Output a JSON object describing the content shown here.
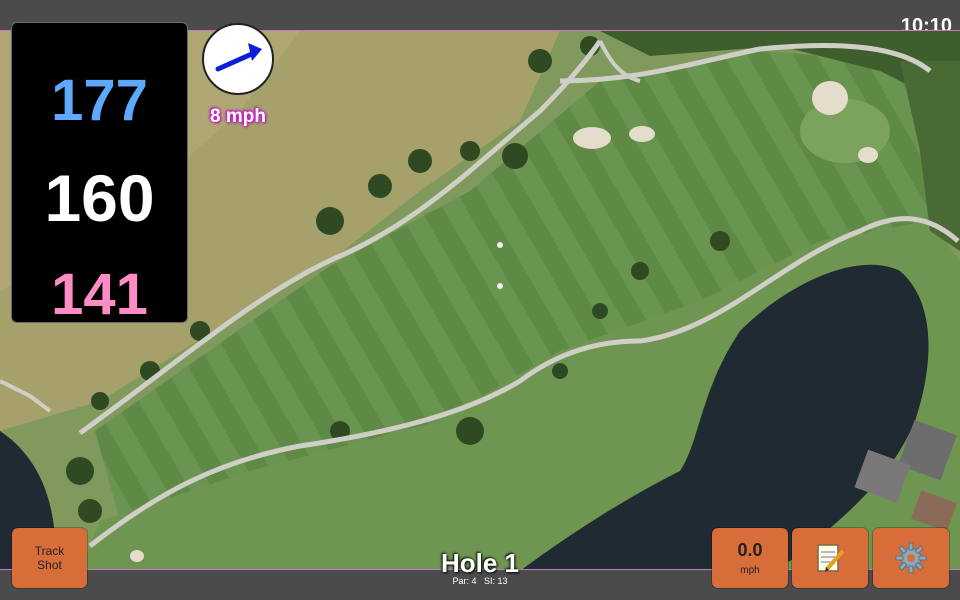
{
  "status": {
    "time": "10:10"
  },
  "distances": {
    "back": "177",
    "middle": "160",
    "front": "141"
  },
  "wind": {
    "speed_text": "8 mph"
  },
  "buttons": {
    "track_shot_label": "Track\nShot",
    "shot_speed_value": "0.0",
    "shot_speed_unit": "mph"
  },
  "hole": {
    "title": "Hole 1",
    "par_label": "Par: 4",
    "si_label": "SI: 13"
  },
  "colors": {
    "back_distance": "#5ea8ff",
    "middle_distance": "#ffffff",
    "front_distance": "#ff8cc4",
    "button": "#d96d3a",
    "wind_arrow": "#0a1ed8"
  },
  "icons": {
    "notes": "notepad-pencil-icon",
    "settings": "gear-icon",
    "wind": "wind-direction-arrow-icon"
  }
}
